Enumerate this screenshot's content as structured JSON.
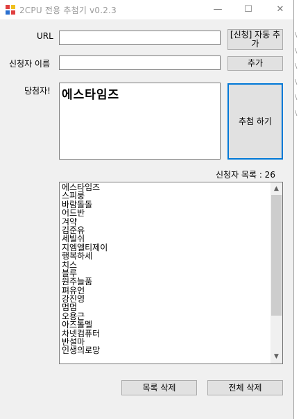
{
  "window": {
    "title": "2CPU 전용 추첨기 v0.2.3",
    "minimize_glyph": "—",
    "maximize_glyph": "☐",
    "close_glyph": "✕",
    "icon": "app-icon"
  },
  "form": {
    "url_label": "URL",
    "url_value": "",
    "applicant_label": "신청자 이름",
    "applicant_value": "",
    "auto_apply_button": "[신청] 자동 추가",
    "add_button": "추가",
    "winner_label": "당첨자!",
    "winner_value": "에스타임즈",
    "draw_button": "추첨 하기",
    "list_count": "신청자 목록 : 26",
    "delete_list_button": "목록 삭제",
    "delete_all_button": "전체 삭제"
  },
  "applicants": [
    "에스타임즈",
    "스피룽",
    "바람돌돌",
    "어드반",
    "겨약",
    "김준유",
    "세빌쉬",
    "지엠엘티제이",
    "행복하세",
    "치스",
    "블루",
    "원주늘품",
    "펴유언",
    "강진영",
    "멈멈",
    "오용근",
    "아즈톨멜",
    "차넷컴퓨터",
    "반설마",
    "인생의로망"
  ],
  "colors": {
    "window_bg": "#f0f0f0",
    "button_bg": "#e1e1e1",
    "focus_border": "#0078d7"
  }
}
